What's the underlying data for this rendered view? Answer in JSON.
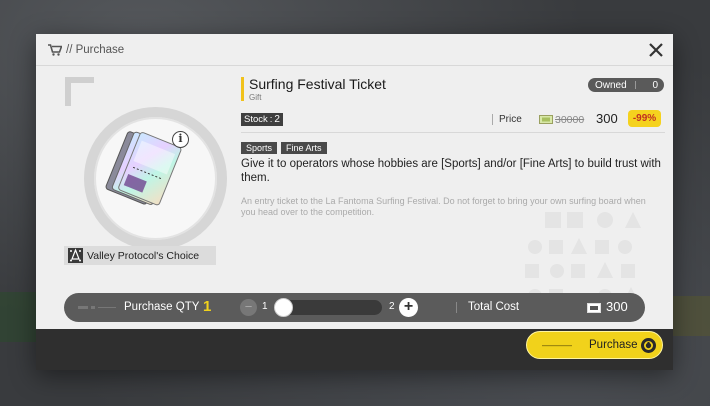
{
  "window": {
    "title": "// Purchase"
  },
  "item": {
    "name": "Surfing Festival Ticket",
    "type": "Gift",
    "owned_label": "Owned",
    "owned_count": "0",
    "stock_label": "Stock",
    "stock_value": "2",
    "price_label": "Price",
    "price_old": "30000",
    "price_new": "300",
    "discount": "-99%",
    "tags": [
      "Sports",
      "Fine Arts"
    ],
    "description": "Give it to operators whose hobbies are [Sports] and/or [Fine Arts] to build trust with them.",
    "flavor": "An entry ticket to the La Fantoma Surfing Festival. Do not forget to bring your own surfing board when you head over to the competition.",
    "source": "Valley Protocol's Choice",
    "info_glyph": "i"
  },
  "quantity": {
    "label": "Purchase QTY",
    "value": "1",
    "min": "1",
    "max": "2",
    "level": 0,
    "minus": "−",
    "plus": "+"
  },
  "cost": {
    "label": "Total Cost",
    "value": "300"
  },
  "footer": {
    "purchase_label": "Purchase"
  },
  "colors": {
    "accent": "#f1d21b",
    "discount_text": "#c23020",
    "panel": "#efefef",
    "dark": "#5b5b5b"
  },
  "icons": [
    "cart-icon",
    "close-icon",
    "info-icon",
    "money-icon",
    "protocol-icon",
    "confirm-icon"
  ]
}
